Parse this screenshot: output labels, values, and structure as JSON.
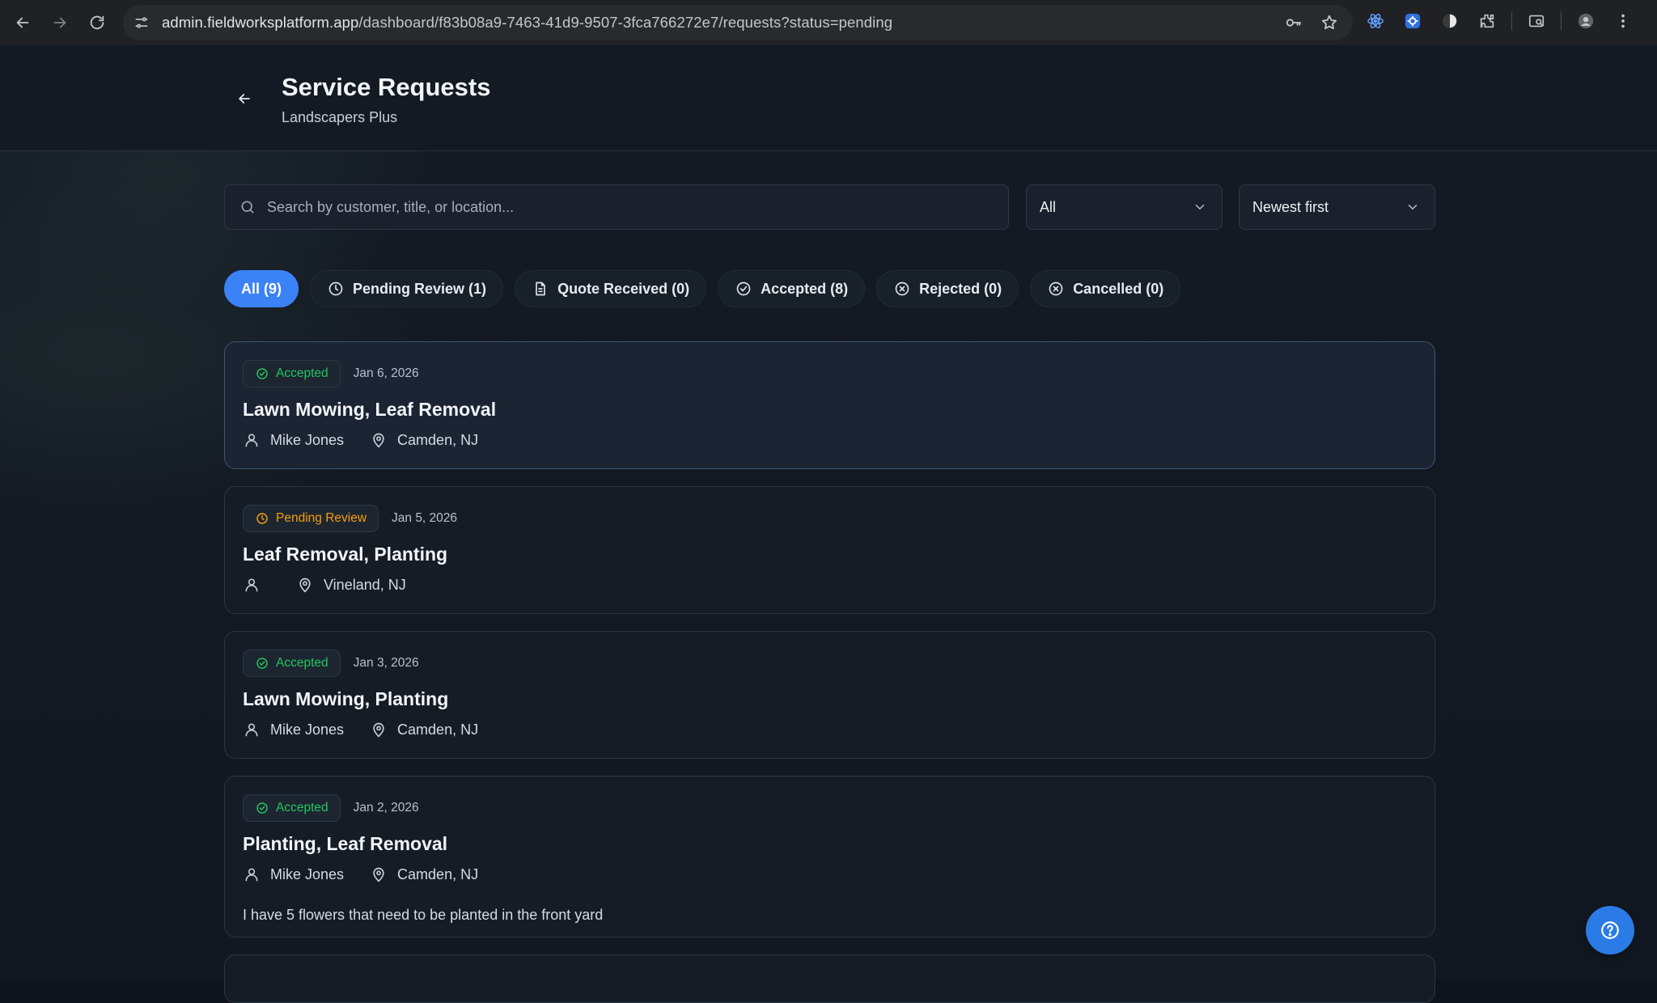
{
  "browser": {
    "url_host": "admin.fieldworksplatform.app",
    "url_path": "/dashboard/f83b08a9-7463-41d9-9507-3fca766272e7/requests?status=pending"
  },
  "header": {
    "title": "Service Requests",
    "subtitle": "Landscapers Plus"
  },
  "search": {
    "placeholder": "Search by customer, title, or location...",
    "value": ""
  },
  "filters": {
    "status_select": "All",
    "sort_select": "Newest first"
  },
  "tabs": [
    {
      "label": "All (9)",
      "icon": "none",
      "active": true
    },
    {
      "label": "Pending Review (1)",
      "icon": "clock-icon",
      "active": false
    },
    {
      "label": "Quote Received (0)",
      "icon": "document-icon",
      "active": false
    },
    {
      "label": "Accepted (8)",
      "icon": "check-circle-icon",
      "active": false
    },
    {
      "label": "Rejected (0)",
      "icon": "x-circle-icon",
      "active": false
    },
    {
      "label": "Cancelled (0)",
      "icon": "x-circle-icon",
      "active": false
    }
  ],
  "requests": [
    {
      "status": "Accepted",
      "date": "Jan 6, 2026",
      "title": "Lawn Mowing, Leaf Removal",
      "customer": "Mike Jones",
      "location": "Camden, NJ",
      "description": ""
    },
    {
      "status": "Pending Review",
      "date": "Jan 5, 2026",
      "title": "Leaf Removal, Planting",
      "customer": "",
      "location": "Vineland, NJ",
      "description": ""
    },
    {
      "status": "Accepted",
      "date": "Jan 3, 2026",
      "title": "Lawn Mowing, Planting",
      "customer": "Mike Jones",
      "location": "Camden, NJ",
      "description": ""
    },
    {
      "status": "Accepted",
      "date": "Jan 2, 2026",
      "title": "Planting, Leaf Removal",
      "customer": "Mike Jones",
      "location": "Camden, NJ",
      "description": "I have 5 flowers that need to be planted in the front yard"
    }
  ],
  "colors": {
    "accent": "#3b82f6",
    "accepted": "#22c55e",
    "pending": "#f59e0b",
    "background": "#141a24"
  }
}
